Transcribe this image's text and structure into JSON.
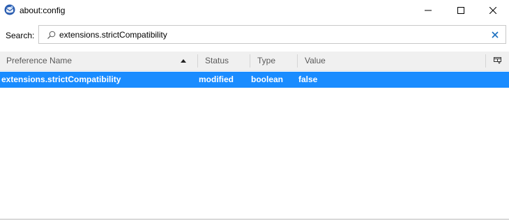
{
  "window": {
    "title": "about:config"
  },
  "search": {
    "label": "Search:",
    "value": "extensions.strictCompatibility",
    "placeholder": ""
  },
  "columns": [
    {
      "label": "Preference Name",
      "sorted": "ascending"
    },
    {
      "label": "Status"
    },
    {
      "label": "Type"
    },
    {
      "label": "Value"
    }
  ],
  "rows": [
    {
      "name": "extensions.strictCompatibility",
      "status": "modified",
      "type": "boolean",
      "value": "false",
      "selected": true
    }
  ],
  "colors": {
    "selection": "#1a8cff",
    "header_bg": "#f0f0f0",
    "clear_icon": "#1a6fbf"
  },
  "icons": {
    "app": "thunderbird-icon",
    "search": "search-icon",
    "clear": "clear-icon",
    "column_picker": "column-picker-icon"
  }
}
